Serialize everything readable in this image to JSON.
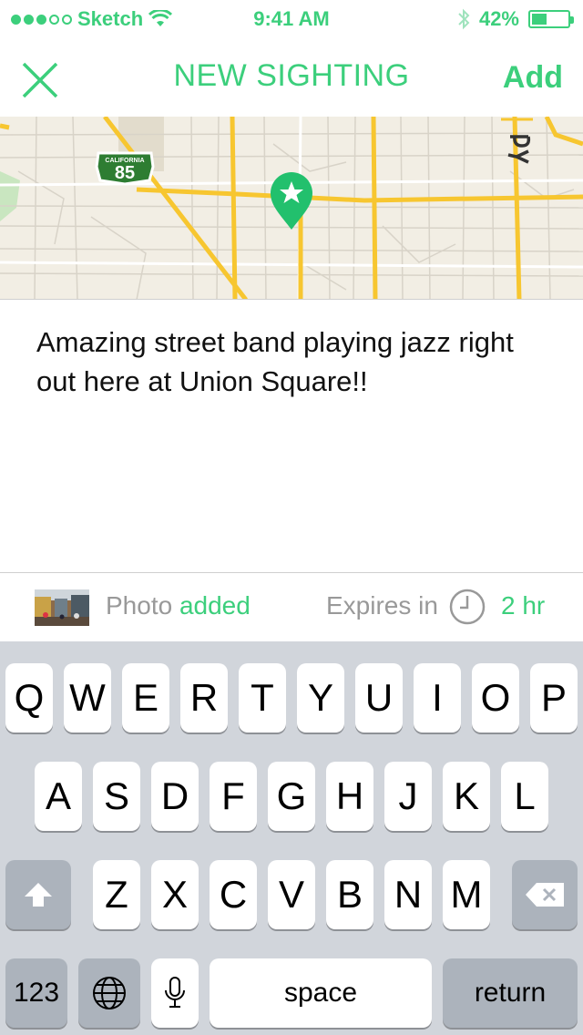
{
  "status_bar": {
    "carrier": "Sketch",
    "time": "9:41 AM",
    "battery_percent": "42%",
    "battery_level": 0.42,
    "signal_dots_filled": 3,
    "signal_dots_total": 5
  },
  "nav": {
    "title": "NEW SIGHTING",
    "add_label": "Add",
    "close_icon": "close-icon"
  },
  "map": {
    "highway_shield_top": "CALIFORNIA",
    "highway_shield_number": "85",
    "pin_icon": "star-pin-icon"
  },
  "note": {
    "text": "Amazing street band playing jazz right out here at Union Square!!"
  },
  "info": {
    "photo_label": "Photo",
    "photo_status": "added",
    "expires_label": "Expires in",
    "expires_value": "2 hr"
  },
  "keyboard": {
    "row1": [
      "Q",
      "W",
      "E",
      "R",
      "T",
      "Y",
      "U",
      "I",
      "O",
      "P"
    ],
    "row2": [
      "A",
      "S",
      "D",
      "F",
      "G",
      "H",
      "J",
      "K",
      "L"
    ],
    "row3": [
      "Z",
      "X",
      "C",
      "V",
      "B",
      "N",
      "M"
    ],
    "numbers_label": "123",
    "space_label": "space",
    "return_label": "return"
  },
  "colors": {
    "accent": "#3ccf7c",
    "map_road_major": "#f7c630",
    "map_background": "#f2eee4"
  }
}
